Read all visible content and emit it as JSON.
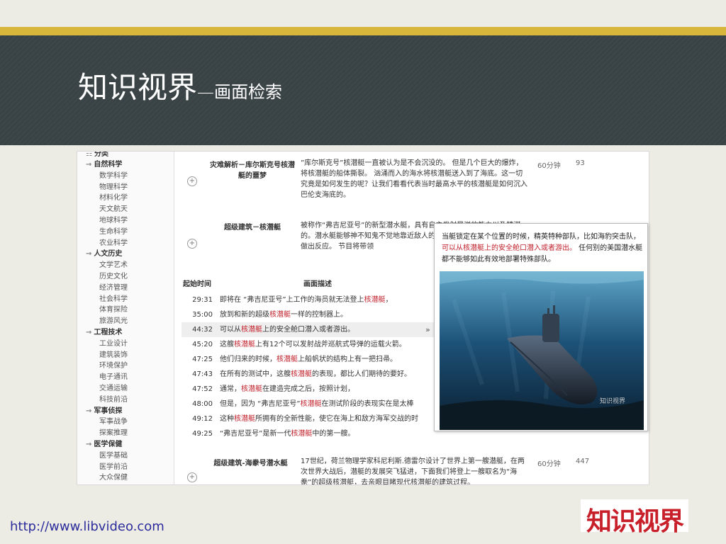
{
  "slide": {
    "title_main": "知识视界",
    "title_sub": "—画面检索",
    "footer_url": "http://www.libvideo.com",
    "logo_text": "知识视界"
  },
  "sidebar": {
    "header": "分类",
    "items": [
      {
        "label": "自然科学",
        "type": "cat"
      },
      {
        "label": "数学科学",
        "type": "sub"
      },
      {
        "label": "物理科学",
        "type": "sub"
      },
      {
        "label": "材料化学",
        "type": "sub"
      },
      {
        "label": "天文航天",
        "type": "sub"
      },
      {
        "label": "地球科学",
        "type": "sub"
      },
      {
        "label": "生命科学",
        "type": "sub"
      },
      {
        "label": "农业科学",
        "type": "sub"
      },
      {
        "label": "人文历史",
        "type": "cat"
      },
      {
        "label": "文学艺术",
        "type": "sub"
      },
      {
        "label": "历史文化",
        "type": "sub"
      },
      {
        "label": "经济管理",
        "type": "sub"
      },
      {
        "label": "社会科学",
        "type": "sub"
      },
      {
        "label": "体育探险",
        "type": "sub"
      },
      {
        "label": "旅游风光",
        "type": "sub"
      },
      {
        "label": "工程技术",
        "type": "cat"
      },
      {
        "label": "工业设计",
        "type": "sub"
      },
      {
        "label": "建筑装饰",
        "type": "sub"
      },
      {
        "label": "环境保护",
        "type": "sub"
      },
      {
        "label": "电子通讯",
        "type": "sub"
      },
      {
        "label": "交通运输",
        "type": "sub"
      },
      {
        "label": "科技前沿",
        "type": "sub"
      },
      {
        "label": "军事侦探",
        "type": "cat"
      },
      {
        "label": "军事战争",
        "type": "sub"
      },
      {
        "label": "探案推理",
        "type": "sub"
      },
      {
        "label": "医学保健",
        "type": "cat"
      },
      {
        "label": "医学基础",
        "type": "sub"
      },
      {
        "label": "医学前沿",
        "type": "sub"
      },
      {
        "label": "大众保健",
        "type": "sub"
      }
    ]
  },
  "videos": [
    {
      "title_line1": "灾难解析－库尔斯克号核潜",
      "title_line2": "艇的噩梦",
      "desc": "”库尔斯克号”核潜艇一直被认为是不会沉没的。 但是几个巨大的爆炸，将核潜艇的船体撕裂。 汹涌而入的海水将核潜艇送入到了海底。这一切究竟是如何发生的呢？让我们看看代表当时最高水平的核潜艇是如何沉入巴伦支海底的。",
      "duration": "60分钟",
      "count": "93"
    },
    {
      "title_line1": "超级建筑－核潜艇",
      "title_line2": "",
      "desc": "被称作“弗吉尼亚号”的新型潜水艇，具有自主发射导弹的能力以及精湛的。潜水艇能够神不知鬼不觉地靠近敌人的海岸线，能够迅雷不及掩耳地做出反应。 节目将带领",
      "duration": "",
      "count": ""
    },
    {
      "title_line1": "超级建筑-海豢号潜水艇",
      "title_line2": "",
      "desc": "17世纪，荷兰物理学家科尼利斯.德雷尔设计了世界上第一艘潜艇，在两次世界大战后，潜艇的发展突飞猛进，下面我们将登上一艘取名为“海豢”的超级核潜艇，去亲眼目睹现代核潜艇的建筑过程。",
      "duration": "60分钟",
      "count": "447"
    }
  ],
  "table": {
    "col_time": "起始时间",
    "col_desc": "画面描述",
    "rows": [
      {
        "t": "29:31",
        "pre": "即将在 “弗吉尼亚号”上工作的海员就无法登上",
        "kw": "核潜艇",
        "post": "，",
        "hl": false
      },
      {
        "t": "35:00",
        "pre": "放到和新的超级",
        "kw": "核潜艇",
        "post": "一样的控制器上。",
        "hl": false
      },
      {
        "t": "44:32",
        "pre": "可以从",
        "kw": "核潜艇",
        "post": "上的安全舱口潜入或者游出。",
        "hl": true
      },
      {
        "t": "45:20",
        "pre": "这艘",
        "kw": "核潜艇",
        "post": "上有12个可以发射战斧巡航式导弹的运载火箭。",
        "hl": false
      },
      {
        "t": "47:25",
        "pre": "他们归来的时候，",
        "kw": "核潜艇",
        "post": "上船帆状的结构上有一把扫帚。",
        "hl": false
      },
      {
        "t": "47:43",
        "pre": "在所有的测试中，这艘",
        "kw": "核潜艇",
        "post": "的表现，都比人们期待的要好。",
        "hl": false
      },
      {
        "t": "47:52",
        "pre": "通常，",
        "kw": "核潜艇",
        "post": "在建造完成之后，按照计划，",
        "hl": false
      },
      {
        "t": "48:00",
        "pre": "但是，因为 “弗吉尼亚号”",
        "kw": "核潜艇",
        "post": "在测试阶段的表现实在是太棒",
        "hl": false
      },
      {
        "t": "49:12",
        "pre": "这种",
        "kw": "核潜艇",
        "post": "所拥有的全新性能，使它在海上和敌方海军交战的时",
        "hl": false
      },
      {
        "t": "49:25",
        "pre": "“弗吉尼亚号”是新一代",
        "kw": "核潜艇",
        "post": "中的第一艘。",
        "hl": false
      }
    ]
  },
  "popup": {
    "text_pre": "当艇锁定在某个位置的时候，精英特种部队，比如海豹突击队，",
    "text_kw": "可以从核潜艇上的安全舱口潜入或者游出。",
    "text_post": " 任何别的美国潜水艇都不能够如此有效地部署特殊部队。",
    "watermark": "知识视界"
  },
  "colors": {
    "keyword": "#c0202a",
    "header_bg": "#3a4345",
    "gold": "#d8b63c",
    "link": "#2c2c9c"
  }
}
